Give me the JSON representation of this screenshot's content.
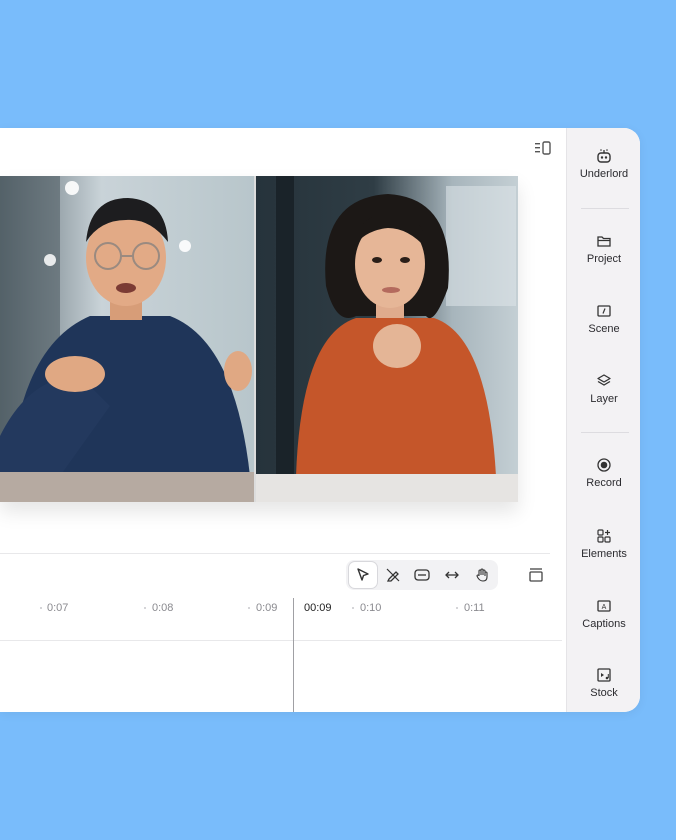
{
  "sidebar": {
    "items": [
      {
        "label": "Underlord",
        "icon": "robot-icon"
      },
      {
        "label": "Project",
        "icon": "folder-icon"
      },
      {
        "label": "Scene",
        "icon": "scene-icon"
      },
      {
        "label": "Layer",
        "icon": "layers-icon"
      },
      {
        "label": "Record",
        "icon": "record-icon"
      },
      {
        "label": "Elements",
        "icon": "elements-icon"
      },
      {
        "label": "Captions",
        "icon": "captions-icon"
      },
      {
        "label": "Stock",
        "icon": "stock-icon"
      }
    ]
  },
  "timeline": {
    "ticks": [
      "0:07",
      "0:08",
      "0:09",
      "0:10",
      "0:11"
    ],
    "current_time": "00:09"
  },
  "toolbar": {
    "tools": [
      "select-tool",
      "blade-tool",
      "ripple-tool",
      "stretch-tool",
      "hand-tool"
    ]
  },
  "colors": {
    "background": "#79bcfb",
    "sidebar": "#f3f2f4"
  }
}
